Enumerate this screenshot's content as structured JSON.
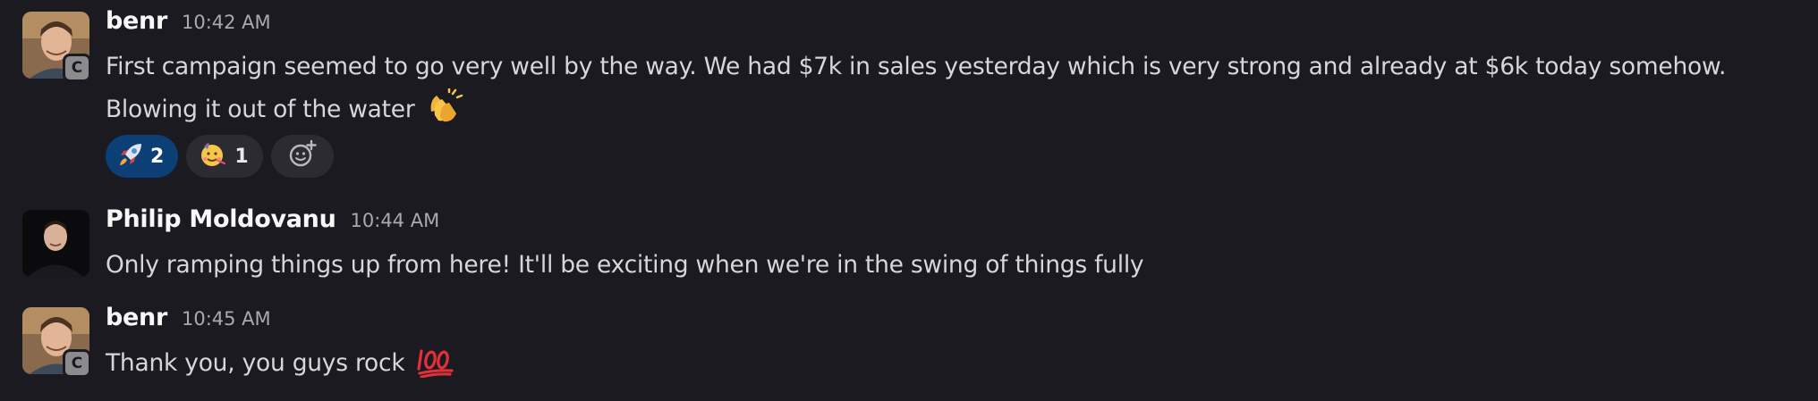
{
  "messages": [
    {
      "author": "benr",
      "time": "10:42 AM",
      "badge": "C",
      "lines": [
        "First campaign seemed to go very well by the way. We had $7k in sales yesterday which is very strong and already at $6k today somehow.",
        "Blowing it out of the water"
      ],
      "line2_emoji": "clapping-hands-emoji",
      "reactions": [
        {
          "emoji": "rocket-emoji",
          "count": "2",
          "active": true
        },
        {
          "emoji": "partying-face-emoji",
          "count": "1",
          "active": false
        }
      ],
      "add_reaction_icon": "add-reaction-icon"
    },
    {
      "author": "Philip Moldovanu",
      "time": "10:44 AM",
      "lines": [
        "Only ramping things up from here! It'll be exciting when we're in the swing of things fully"
      ]
    },
    {
      "author": "benr",
      "time": "10:45 AM",
      "badge": "C",
      "lines": [
        "Thank you, you guys rock"
      ],
      "line1_emoji": "hundred-points-emoji"
    }
  ],
  "colors": {
    "background": "#1b1a20",
    "active_reaction": "#0b3f75",
    "reaction": "#2b2b31",
    "author": "#f8f8f8",
    "timestamp": "#a9aaad"
  }
}
